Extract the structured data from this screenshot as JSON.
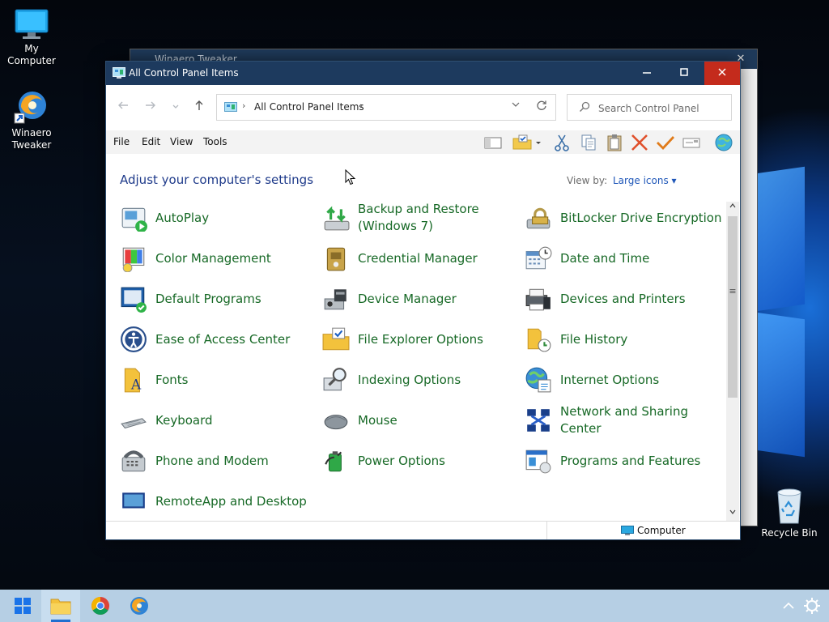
{
  "desktop": {
    "icons": [
      {
        "label": "My Computer"
      },
      {
        "label": "Winaero\nTweaker"
      },
      {
        "label": "Recycle Bin"
      }
    ],
    "background_window_title": "Winaero Tweaker"
  },
  "window": {
    "title": "All Control Panel Items",
    "buttons": {
      "minimize": "—",
      "maximize": "□",
      "close": "✕"
    },
    "address": {
      "crumb": "All Control Panel Items"
    },
    "search": {
      "placeholder": "Search Control Panel"
    },
    "menu": [
      "File",
      "Edit",
      "View",
      "Tools"
    ],
    "heading": "Adjust your computer's settings",
    "view_by": {
      "label": "View by:",
      "value": "Large icons ▾"
    },
    "items": [
      {
        "label": "AutoPlay",
        "icon": "autoplay-icon"
      },
      {
        "label": "Backup and Restore\n(Windows 7)",
        "icon": "backup-restore-icon"
      },
      {
        "label": "BitLocker Drive Encryption",
        "icon": "bitlocker-icon"
      },
      {
        "label": "Color Management",
        "icon": "color-management-icon"
      },
      {
        "label": "Credential Manager",
        "icon": "credential-manager-icon"
      },
      {
        "label": "Date and Time",
        "icon": "date-time-icon"
      },
      {
        "label": "Default Programs",
        "icon": "default-programs-icon"
      },
      {
        "label": "Device Manager",
        "icon": "device-manager-icon"
      },
      {
        "label": "Devices and Printers",
        "icon": "devices-printers-icon"
      },
      {
        "label": "Ease of Access Center",
        "icon": "ease-of-access-icon"
      },
      {
        "label": "File Explorer Options",
        "icon": "file-explorer-options-icon"
      },
      {
        "label": "File History",
        "icon": "file-history-icon"
      },
      {
        "label": "Fonts",
        "icon": "fonts-icon"
      },
      {
        "label": "Indexing Options",
        "icon": "indexing-options-icon"
      },
      {
        "label": "Internet Options",
        "icon": "internet-options-icon"
      },
      {
        "label": "Keyboard",
        "icon": "keyboard-icon"
      },
      {
        "label": "Mouse",
        "icon": "mouse-icon"
      },
      {
        "label": "Network and Sharing\nCenter",
        "icon": "network-sharing-icon"
      },
      {
        "label": "Phone and Modem",
        "icon": "phone-modem-icon"
      },
      {
        "label": "Power Options",
        "icon": "power-options-icon"
      },
      {
        "label": "Programs and Features",
        "icon": "programs-features-icon"
      },
      {
        "label": "RemoteApp and Desktop",
        "icon": "remoteapp-icon"
      }
    ],
    "status": {
      "location": "Computer"
    }
  },
  "taskbar": {
    "apps": [
      "start-button",
      "file-explorer",
      "chrome",
      "winaero-tweaker"
    ],
    "tray": [
      "chevron-up-icon",
      "gear-icon"
    ]
  },
  "colors": {
    "titlebar": "#1d3a5e",
    "link_green": "#176926",
    "heading_blue": "#1e3a8a",
    "close_red": "#c42b1c",
    "taskbar": "#b6cfe4"
  }
}
